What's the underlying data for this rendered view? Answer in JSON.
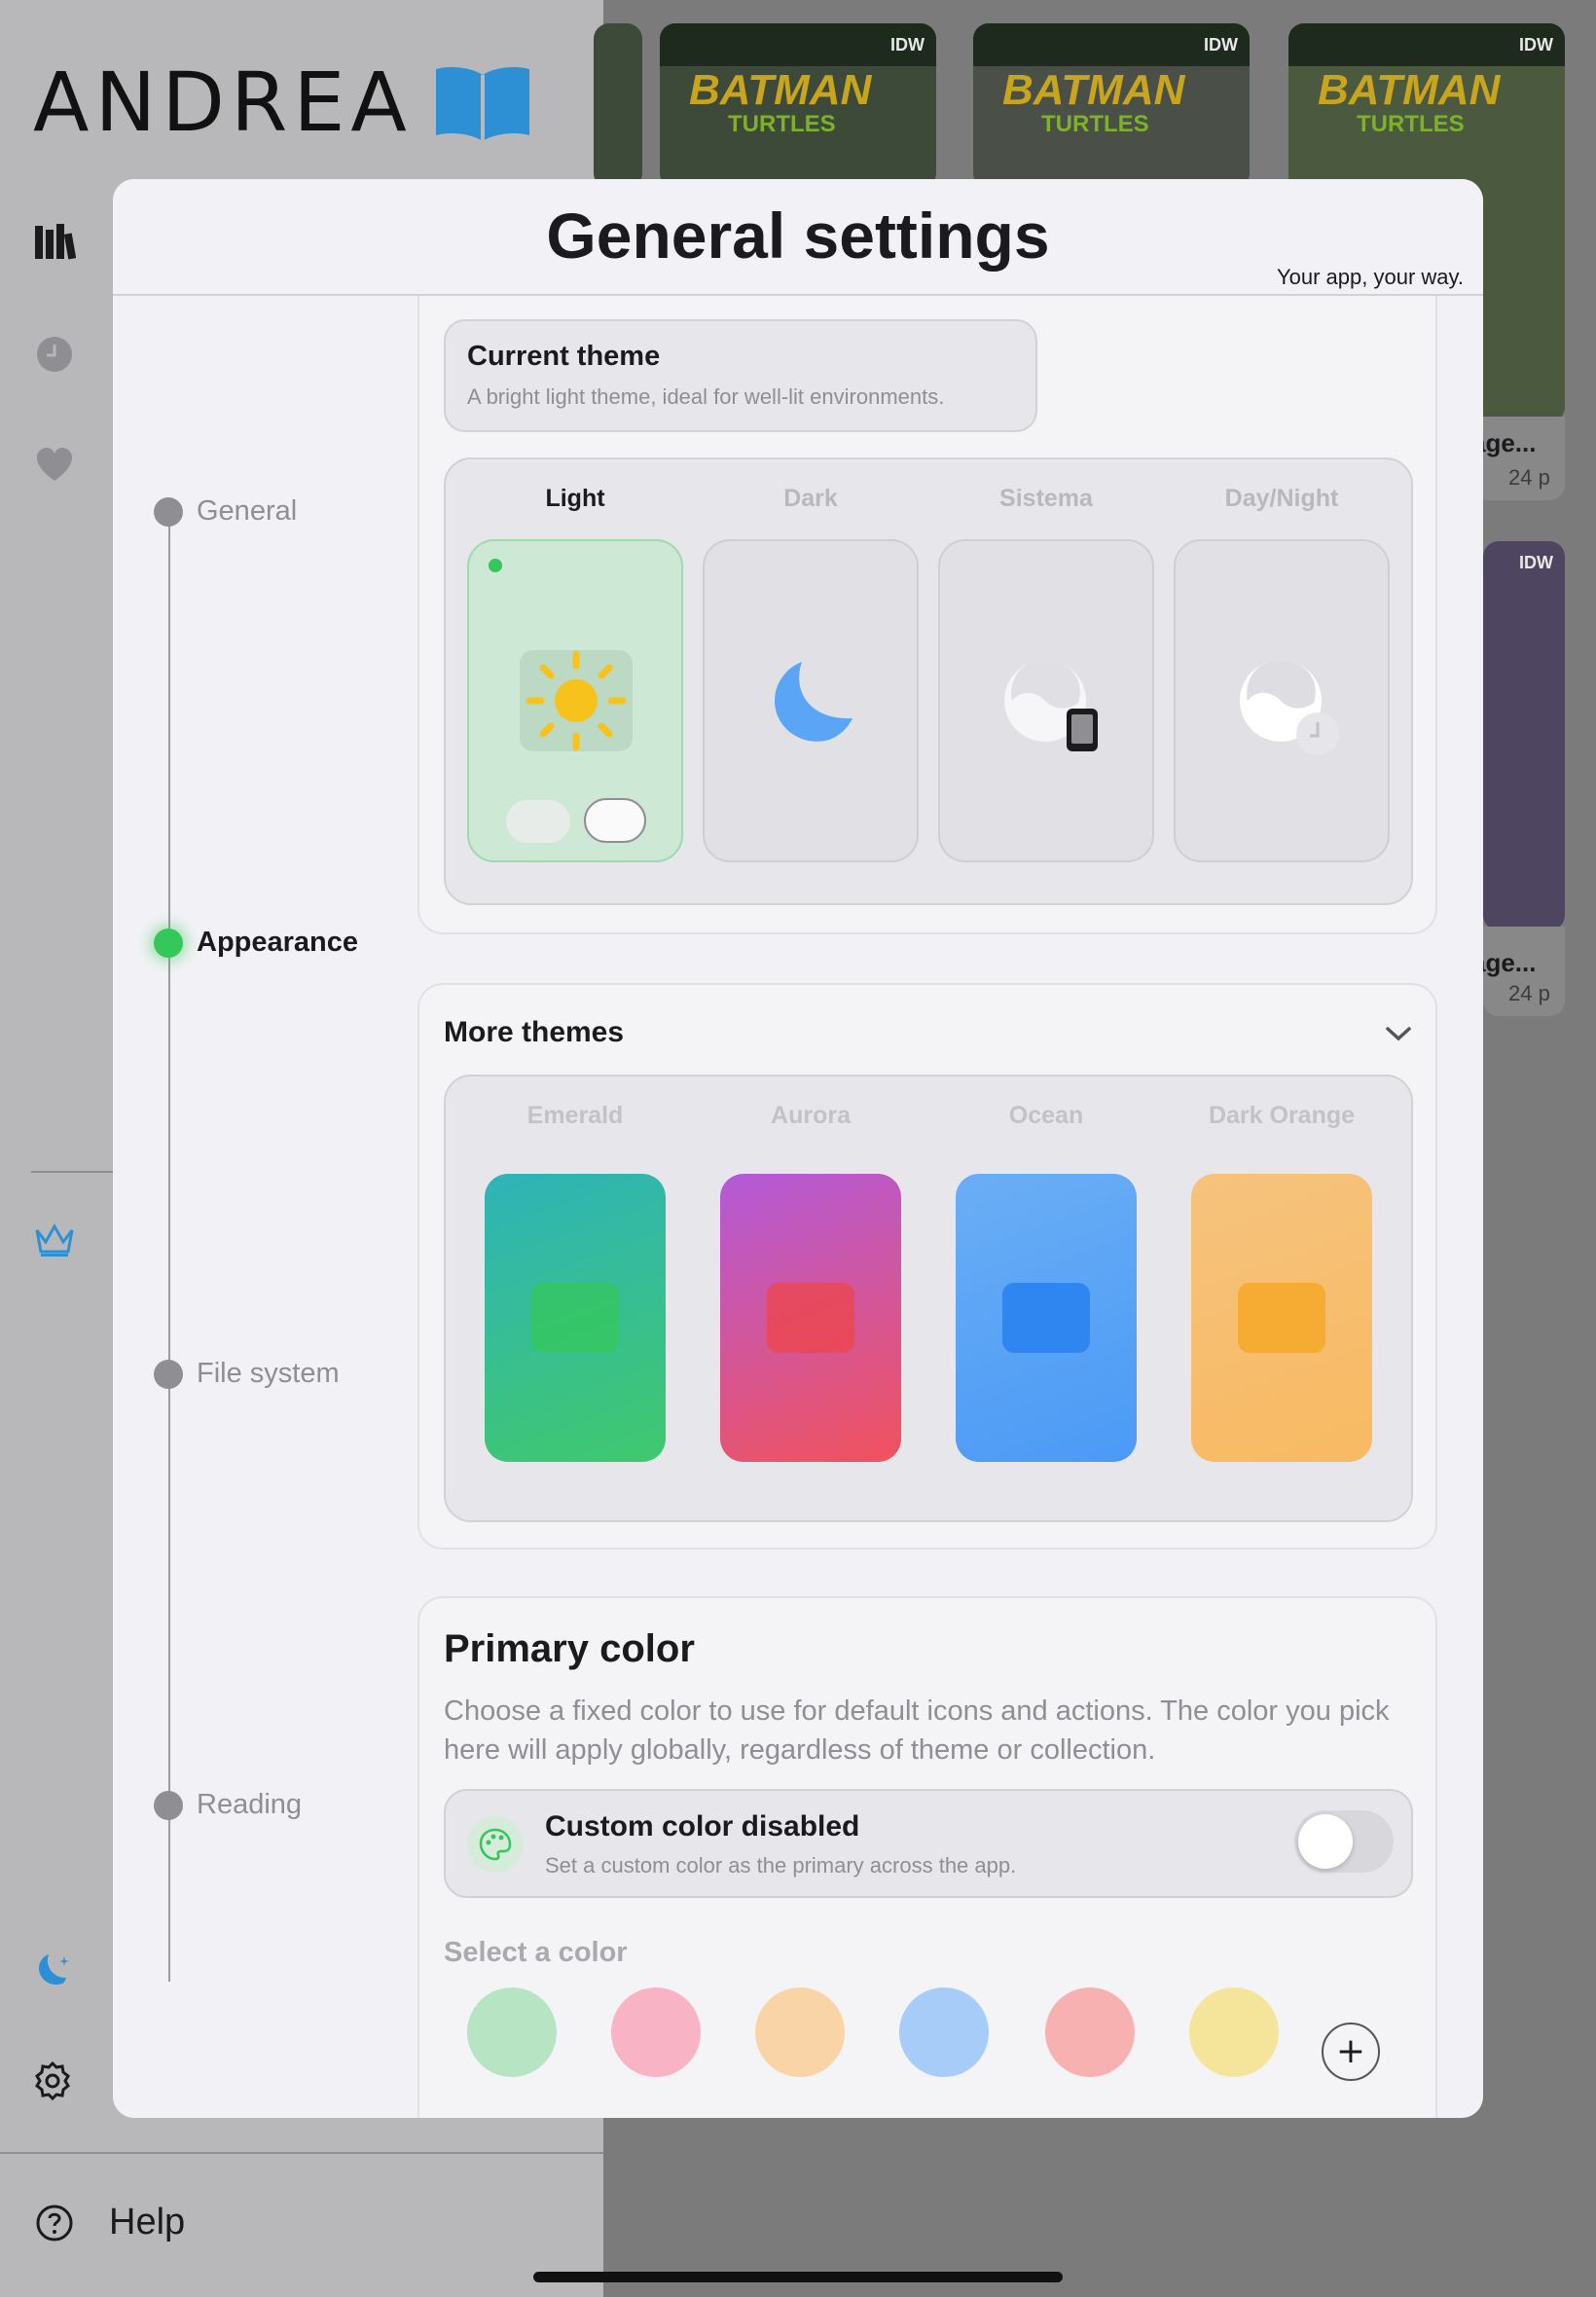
{
  "app": {
    "logo_text": "ANDREA",
    "help_label": "Help"
  },
  "background_cards": [
    {
      "brand": "IDW",
      "title": "BATMAN",
      "subtitle": "TURTLES"
    },
    {
      "brand": "IDW",
      "title": "BATMAN",
      "subtitle": "TURTLES"
    },
    {
      "brand": "IDW",
      "title": "BATMAN",
      "subtitle": "TURTLES"
    }
  ],
  "background_meta": [
    {
      "title": "age...",
      "pages": "24 p"
    },
    {
      "title": "age...",
      "pages": "24 p"
    }
  ],
  "modal": {
    "title": "General settings",
    "subtitle": "Your app, your way."
  },
  "timeline": [
    {
      "label": "General",
      "active": false
    },
    {
      "label": "Appearance",
      "active": true
    },
    {
      "label": "File system",
      "active": false
    },
    {
      "label": "Reading",
      "active": false
    }
  ],
  "current_theme": {
    "title": "Current theme",
    "description": "A bright light theme, ideal for well-lit environments."
  },
  "themes": [
    {
      "name": "Light",
      "selected": true,
      "icon": "sun-icon"
    },
    {
      "name": "Dark",
      "selected": false,
      "icon": "moon-icon"
    },
    {
      "name": "Sistema",
      "selected": false,
      "icon": "system-theme-icon"
    },
    {
      "name": "Day/Night",
      "selected": false,
      "icon": "day-night-icon"
    }
  ],
  "more_themes": {
    "title": "More themes",
    "palettes": [
      {
        "name": "Emerald",
        "from": "#2fb3b8",
        "to": "#40c96d",
        "accent": "#34c759"
      },
      {
        "name": "Aurora",
        "from": "#b35ad8",
        "to": "#f1525c",
        "accent": "#ef4444"
      },
      {
        "name": "Ocean",
        "from": "#6aaef5",
        "to": "#4b9af6",
        "accent": "#2f86f1"
      },
      {
        "name": "Dark Orange",
        "from": "#f6c27d",
        "to": "#f8ba62",
        "accent": "#f5a623"
      }
    ]
  },
  "primary_color": {
    "title": "Primary color",
    "description": "Choose a fixed color to use for default icons and actions. The color you pick here will apply globally, regardless of theme or collection.",
    "custom_title": "Custom color disabled",
    "custom_subtitle": "Set a custom color as the primary across the app.",
    "custom_enabled": false,
    "select_label": "Select a color",
    "swatches": [
      "#b7e4c3",
      "#f8b3c4",
      "#f9d4a7",
      "#a8ccf8",
      "#f7b1b1",
      "#f5e59a"
    ],
    "add_label": "+"
  },
  "colors": {
    "accent_green": "#34c759",
    "brand_blue": "#2d8fd4"
  }
}
